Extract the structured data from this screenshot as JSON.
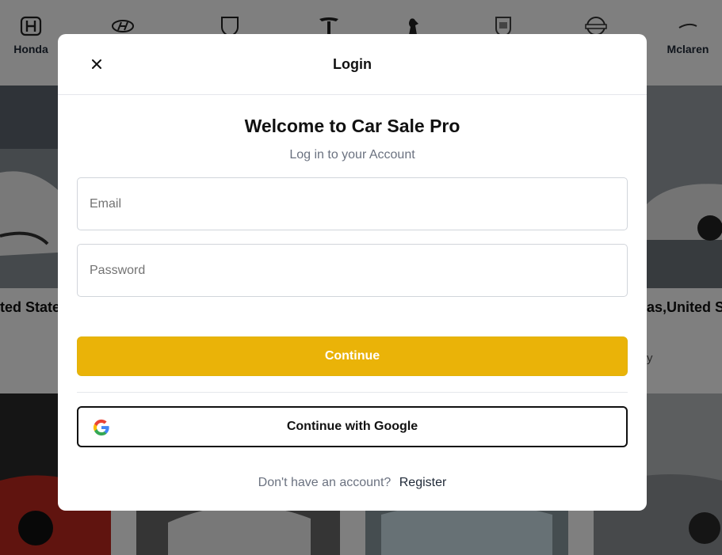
{
  "background": {
    "brands": [
      {
        "name": "Honda",
        "icon": "honda-logo-icon"
      },
      {
        "name": "",
        "icon": "hyundai-logo-icon"
      },
      {
        "name": "",
        "icon": "lamborghini-logo-icon"
      },
      {
        "name": "",
        "icon": "tesla-logo-icon"
      },
      {
        "name": "",
        "icon": "ferrari-logo-icon"
      },
      {
        "name": "",
        "icon": "porsche-logo-icon"
      },
      {
        "name": "",
        "icon": "nissan-logo-icon"
      },
      {
        "name": "Mclaren",
        "icon": "mclaren-logo-icon"
      }
    ],
    "listings": [
      {
        "location": "ted State"
      },
      {
        "location": "as,United S",
        "sub": "y"
      }
    ]
  },
  "modal": {
    "title": "Login",
    "welcome": "Welcome to Car Sale Pro",
    "subtitle": "Log in to your Account",
    "email_placeholder": "Email",
    "password_placeholder": "Password",
    "continue_label": "Continue",
    "google_label": "Continue with Google",
    "no_account_text": "Don't have an account?",
    "register_label": "Register"
  },
  "colors": {
    "accent": "#eab308",
    "overlay": "rgba(0,0,0,0.5)"
  }
}
